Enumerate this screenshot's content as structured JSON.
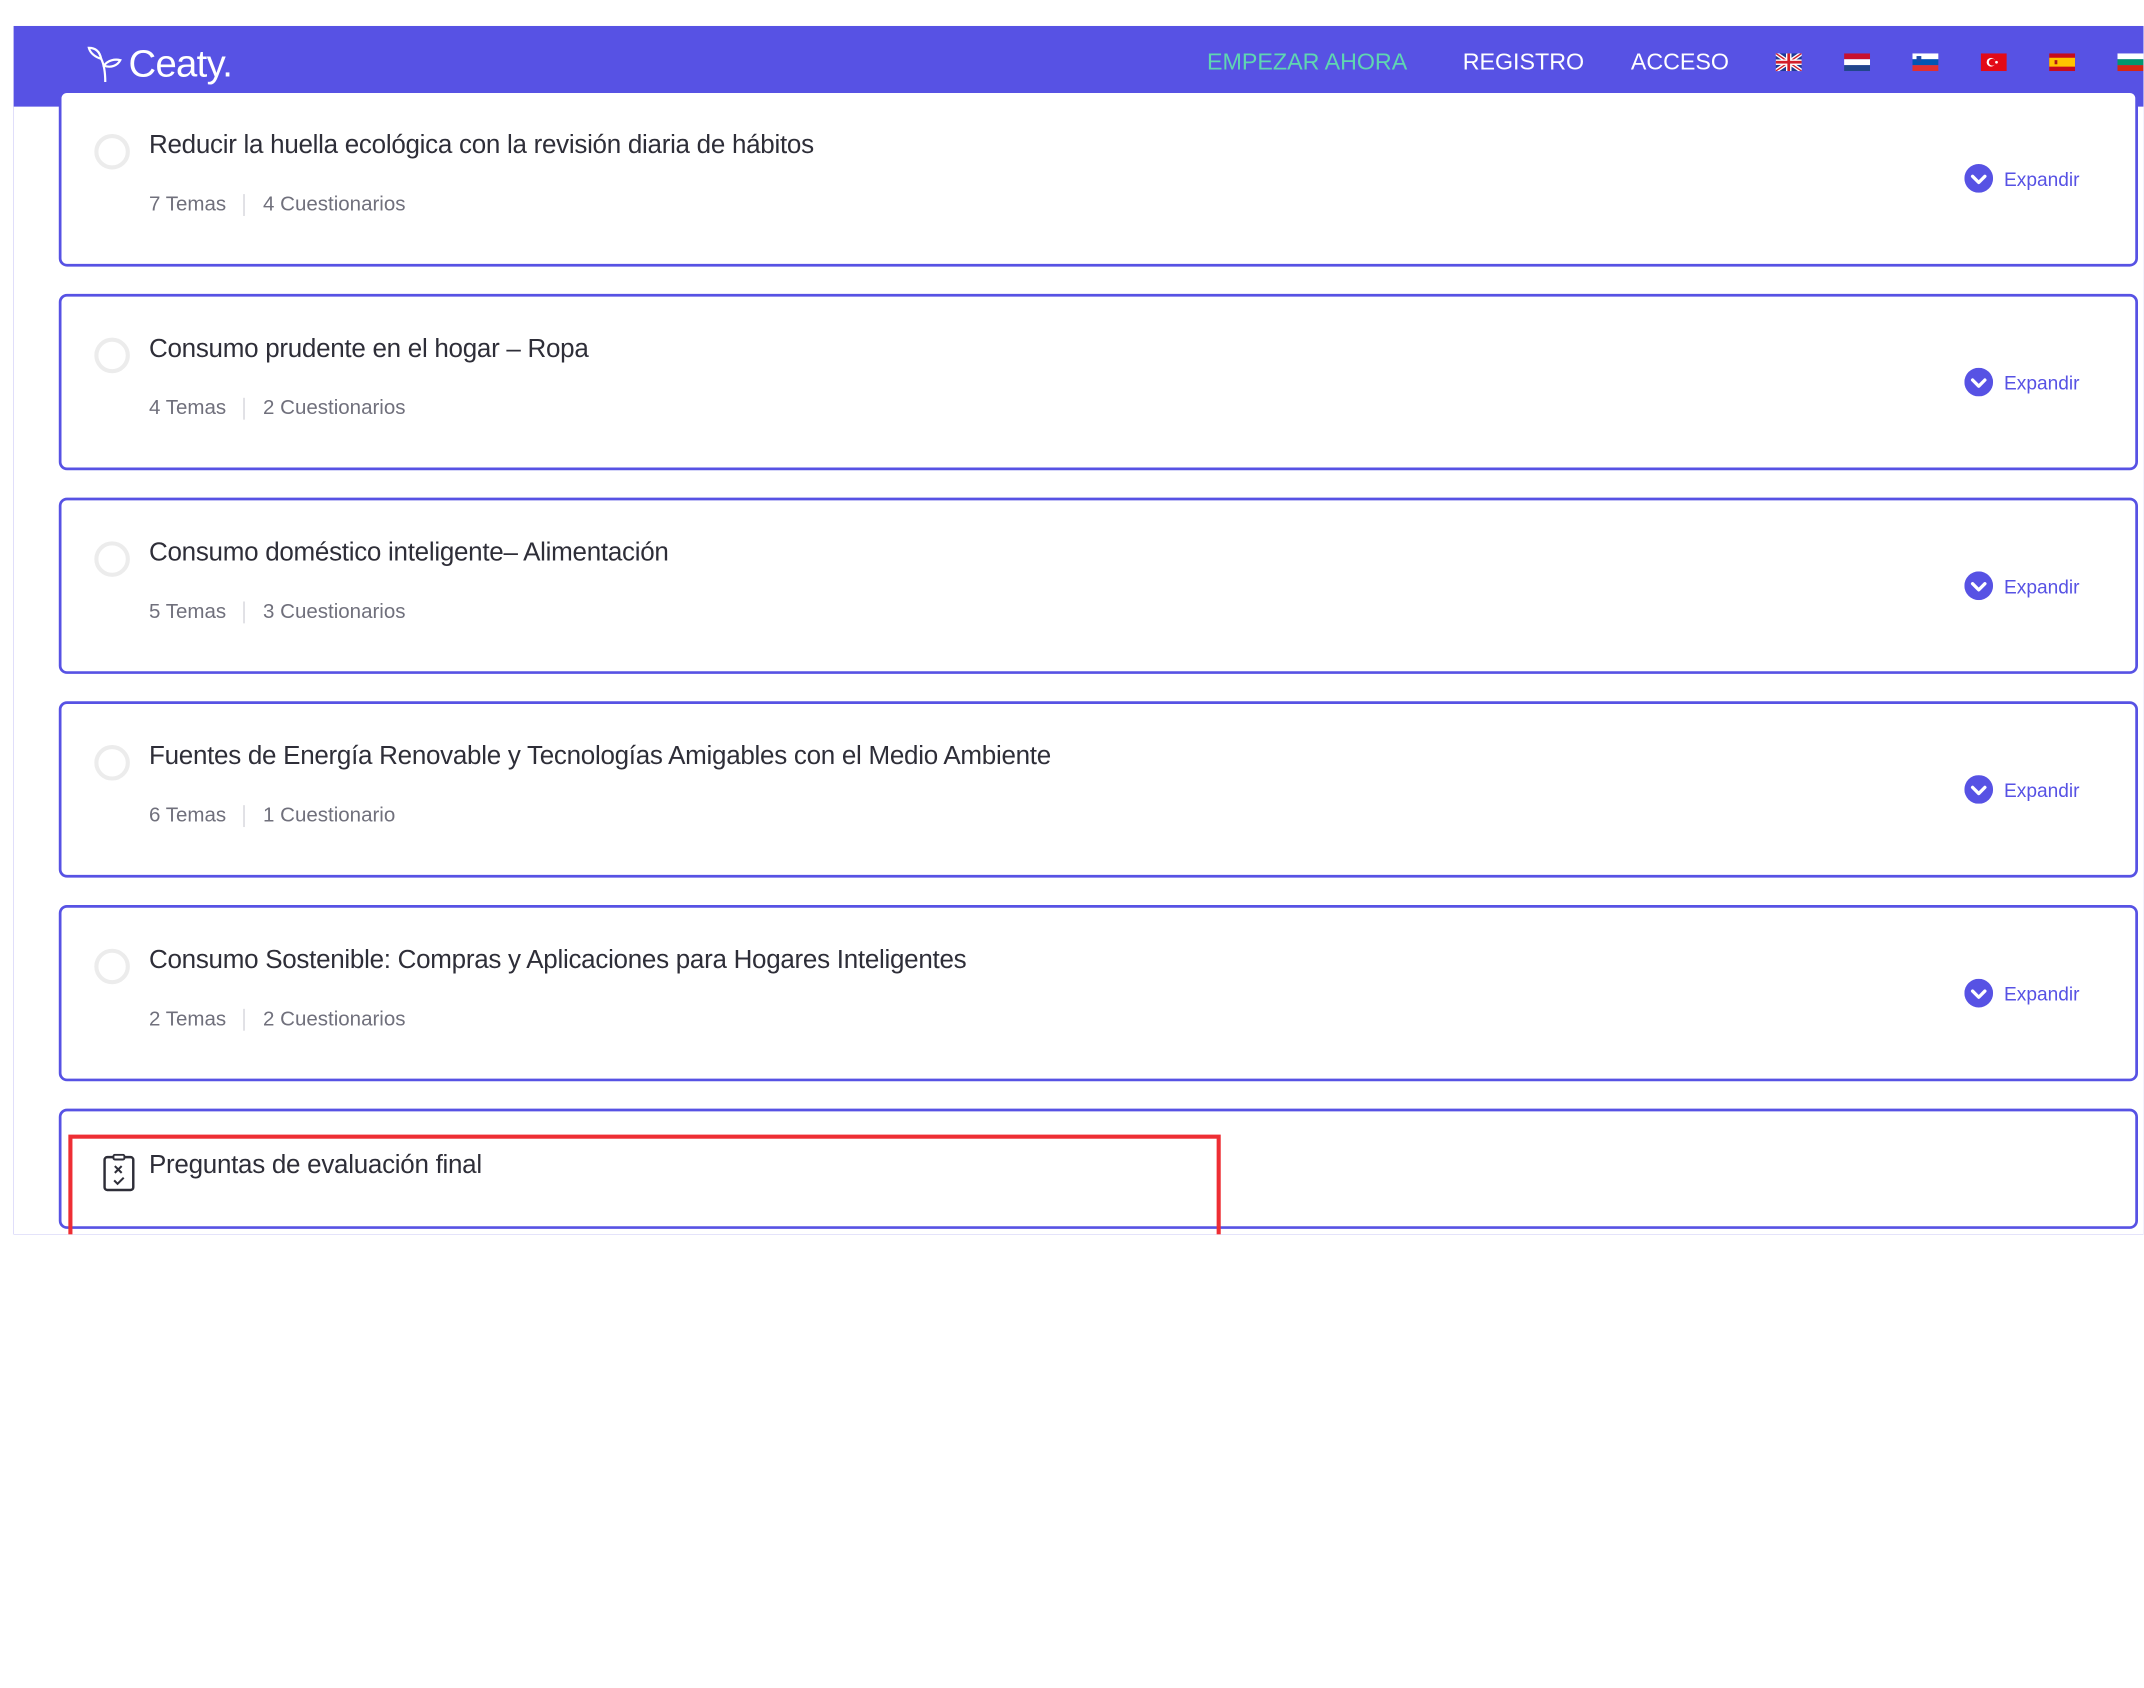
{
  "brand": {
    "name": "Ceaty."
  },
  "nav": {
    "start_label": "EMPEZAR AHORA",
    "register_label": "REGISTRO",
    "login_label": "ACCESO"
  },
  "languages": [
    {
      "icon": "uk-flag-icon"
    },
    {
      "icon": "netherlands-flag-icon"
    },
    {
      "icon": "slovenia-flag-icon"
    },
    {
      "icon": "turkey-flag-icon"
    },
    {
      "icon": "spain-flag-icon"
    },
    {
      "icon": "bulgaria-flag-icon"
    }
  ],
  "expand_label": "Expandir",
  "modules": [
    {
      "title": "Reducir la huella ecológica con la revisión diaria de hábitos",
      "topics": "7 Temas",
      "quizzes": "4 Cuestionarios"
    },
    {
      "title": "Consumo prudente en el hogar – Ropa",
      "topics": "4 Temas",
      "quizzes": "2 Cuestionarios"
    },
    {
      "title": "Consumo doméstico inteligente– Alimentación",
      "topics": "5 Temas",
      "quizzes": "3 Cuestionarios"
    },
    {
      "title": "Fuentes de Energía Renovable y Tecnologías Amigables con el Medio Ambiente",
      "topics": "6 Temas",
      "quizzes": "1 Cuestionario"
    },
    {
      "title": "Consumo Sostenible: Compras y Aplicaciones para Hogares Inteligentes",
      "topics": "2 Temas",
      "quizzes": "2 Cuestionarios"
    }
  ],
  "final_quiz": {
    "title": "Preguntas de evaluación final",
    "icon": "quiz-icon"
  },
  "colors": {
    "primary": "#5752e4",
    "accent": "#5fd6b1",
    "highlight": "#ee2e34"
  }
}
